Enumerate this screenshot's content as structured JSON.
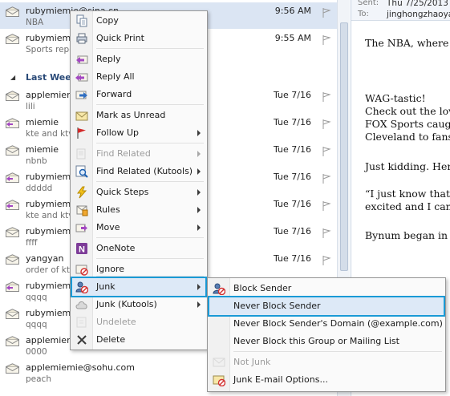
{
  "colors": {
    "selected_row": "#dbe5f3",
    "highlight_border": "#1a9ad6",
    "menu_bg": "#fafafa"
  },
  "mail_list": {
    "group_header": "Last Week",
    "items": [
      {
        "sender": "rubymiemie@sina.cn",
        "preview": "NBA",
        "date": "9:56 AM",
        "selected": true,
        "icon": "envelope-open-icon"
      },
      {
        "sender": "rubymiemie@sina.cn",
        "preview": "Sports report",
        "date": "9:55 AM",
        "icon": "envelope-open-icon"
      },
      {
        "sender": "applemiemie@sohu.com",
        "preview": "lili",
        "date": "Tue 7/16",
        "icon": "envelope-open-icon"
      },
      {
        "sender": "miemie",
        "preview": "kte and ktv",
        "date": "Tue 7/16",
        "icon": "reply-envelope-icon"
      },
      {
        "sender": "miemie",
        "preview": "nbnb",
        "date": "Tue 7/16",
        "icon": "envelope-open-icon"
      },
      {
        "sender": "rubymiemie@sina.cn",
        "preview": "ddddd",
        "date": "Tue 7/16",
        "icon": "reply-envelope-icon"
      },
      {
        "sender": "rubymiemie@sina.cn",
        "preview": "kte and ktv",
        "date": "Tue 7/16",
        "icon": "reply-envelope-icon"
      },
      {
        "sender": "rubymiemie@sina.cn",
        "preview": "ffff",
        "date": "Tue 7/16",
        "icon": "envelope-open-icon"
      },
      {
        "sender": "yangyan",
        "preview": "order of ktv",
        "date": "Tue 7/16",
        "icon": "envelope-open-icon"
      },
      {
        "sender": "rubymiemie@sina.cn",
        "preview": "qqqq",
        "date": "Tue 7/16",
        "icon": "reply-envelope-icon"
      },
      {
        "sender": "rubymiemie@sina.cn",
        "preview": "qqqq",
        "date": "Tue 7/16",
        "icon": "envelope-open-icon"
      },
      {
        "sender": "applemiemie@sohu.com",
        "preview": "0000",
        "date": "Tue 7/16",
        "icon": "envelope-open-icon"
      },
      {
        "sender": "applemiemie@sohu.com",
        "preview": "peach",
        "date": "Tue 7/16",
        "icon": "envelope-open-icon"
      }
    ]
  },
  "reading_pane": {
    "sent_label": "Sent:",
    "sent_value": "Thu 7/25/2013 9:56 AM",
    "to_label": "To:",
    "to_value": "jinghongzhaoyang",
    "body_lines": [
      "The NBA, where it",
      "WAG-tastic!",
      "Check out the love",
      "FOX Sports caugh",
      "Cleveland to fans i",
      "Just kidding. Here",
      "“I just know that th",
      "excited and I can't",
      "Bynum began in ca"
    ]
  },
  "context_menu": {
    "items": [
      {
        "label": "Copy",
        "icon": "copy-icon"
      },
      {
        "label": "Quick Print",
        "icon": "print-icon"
      },
      {
        "label": "Reply",
        "icon": "reply-icon"
      },
      {
        "label": "Reply All",
        "icon": "reply-all-icon"
      },
      {
        "label": "Forward",
        "icon": "forward-icon"
      },
      {
        "label": "Mark as Unread",
        "icon": "mark-unread-icon"
      },
      {
        "label": "Follow Up",
        "icon": "flag-icon",
        "submenu": true
      },
      {
        "label": "Find Related",
        "icon": "find-related-icon",
        "submenu": true,
        "disabled": true
      },
      {
        "label": "Find Related (Kutools)",
        "icon": "magnifier-icon",
        "submenu": true
      },
      {
        "label": "Quick Steps",
        "icon": "lightning-icon",
        "submenu": true
      },
      {
        "label": "Rules",
        "icon": "rules-icon",
        "submenu": true
      },
      {
        "label": "Move",
        "icon": "move-icon",
        "submenu": true
      },
      {
        "label": "OneNote",
        "icon": "onenote-icon"
      },
      {
        "label": "Ignore",
        "icon": "ignore-icon"
      },
      {
        "label": "Junk",
        "icon": "junk-icon",
        "submenu": true,
        "highlighted": true
      },
      {
        "label": "Junk (Kutools)",
        "icon": "cloud-icon",
        "submenu": true
      },
      {
        "label": "Undelete",
        "icon": "undelete-icon",
        "disabled": true
      },
      {
        "label": "Delete",
        "icon": "delete-icon"
      }
    ]
  },
  "junk_submenu": {
    "items": [
      {
        "label": "Block Sender",
        "icon": "block-sender-icon"
      },
      {
        "label": "Never Block Sender",
        "icon": "",
        "highlighted": true
      },
      {
        "label": "Never Block Sender's Domain (@example.com)",
        "icon": ""
      },
      {
        "label": "Never Block this Group or Mailing List",
        "icon": ""
      },
      {
        "label": "Not Junk",
        "icon": "not-junk-icon",
        "disabled": true
      },
      {
        "label": "Junk E-mail Options...",
        "icon": "junk-options-icon"
      }
    ]
  }
}
